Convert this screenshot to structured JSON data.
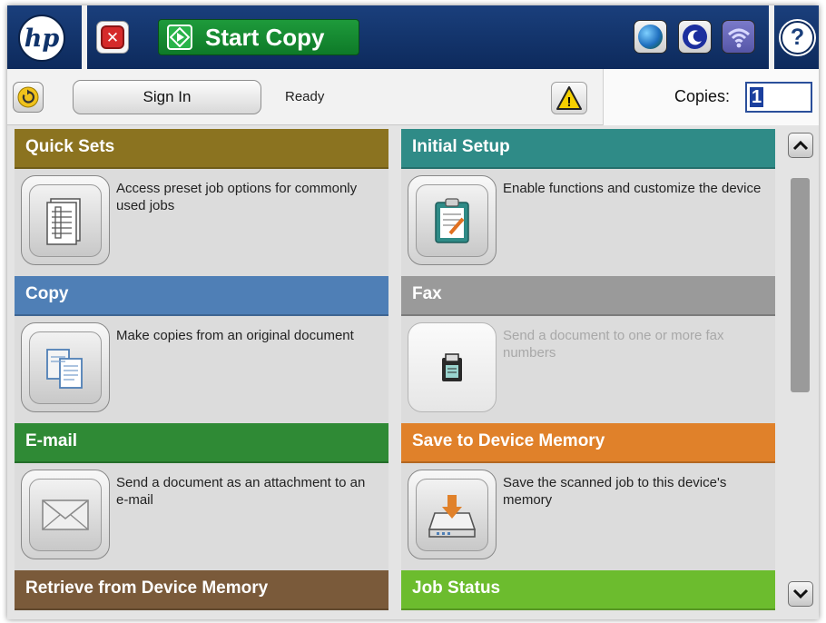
{
  "topbar": {
    "logo": "hp",
    "stop_symbol": "✕",
    "start_copy_label": "Start Copy",
    "help_symbol": "?"
  },
  "statusbar": {
    "sign_in_label": "Sign In",
    "status_text": "Ready",
    "copies_label": "Copies:",
    "copies_value": "1"
  },
  "tiles": [
    {
      "title": "Quick Sets",
      "description": "Access preset job options for commonly used jobs",
      "color": "#8b7320",
      "icon": "quick-sets-icon",
      "enabled": true
    },
    {
      "title": "Initial Setup",
      "description": "Enable functions and customize the device",
      "color": "#2f8b87",
      "icon": "clipboard-icon",
      "enabled": true
    },
    {
      "title": "Copy",
      "description": "Make copies from an original document",
      "color": "#4f7fb6",
      "icon": "copy-documents-icon",
      "enabled": true
    },
    {
      "title": "Fax",
      "description": "Send a document to one or more fax numbers",
      "color": "#9a9a9a",
      "icon": "fax-icon",
      "enabled": false
    },
    {
      "title": "E-mail",
      "description": "Send a document as an attachment to an e-mail",
      "color": "#2f8a35",
      "icon": "envelope-icon",
      "enabled": true
    },
    {
      "title": "Save to Device Memory",
      "description": "Save the scanned job to this device's memory",
      "color": "#e0812a",
      "icon": "save-to-memory-icon",
      "enabled": true
    },
    {
      "title": "Retrieve from Device Memory",
      "description": "",
      "color": "#7a5a3a",
      "icon": "",
      "enabled": true
    },
    {
      "title": "Job Status",
      "description": "",
      "color": "#6cbc2e",
      "icon": "",
      "enabled": true
    }
  ],
  "colors": {
    "topbar": "#0d2a5c",
    "start_copy": "#1e9a3b",
    "stop": "#d52a2a",
    "warning": "#f5d000"
  }
}
